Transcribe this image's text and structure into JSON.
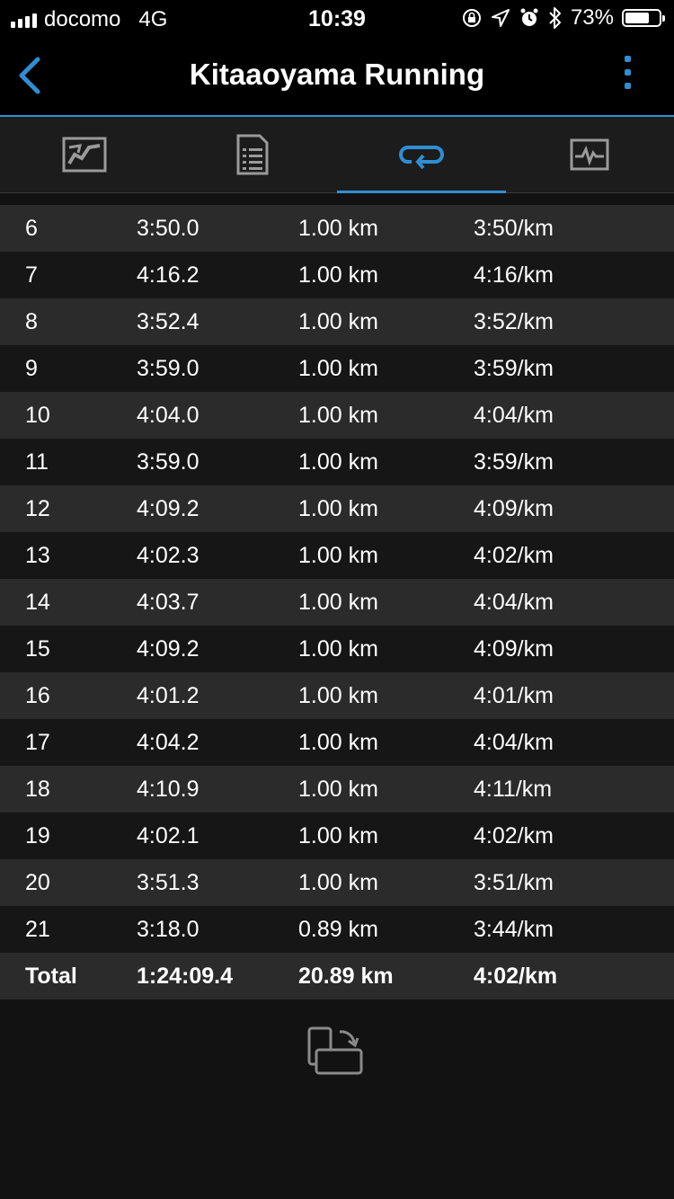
{
  "status_bar": {
    "carrier": "docomo",
    "network": "4G",
    "time": "10:39",
    "battery": "73%",
    "battery_level": 0.73,
    "icons": [
      "orientation-lock-icon",
      "location-icon",
      "alarm-icon",
      "bluetooth-icon"
    ]
  },
  "header": {
    "title": "Kitaaoyama Running",
    "back_icon": "chevron-left-icon",
    "more_icon": "vertical-dots-icon",
    "accent": "#2f8ed3"
  },
  "tabs": [
    {
      "icon": "map-icon",
      "active": false
    },
    {
      "icon": "summary-list-icon",
      "active": false
    },
    {
      "icon": "laps-icon",
      "active": true
    },
    {
      "icon": "charts-icon",
      "active": false
    }
  ],
  "laps": {
    "rows": [
      {
        "lap": "6",
        "time": "3:50.0",
        "distance": "1.00 km",
        "pace": "3:50/km"
      },
      {
        "lap": "7",
        "time": "4:16.2",
        "distance": "1.00 km",
        "pace": "4:16/km"
      },
      {
        "lap": "8",
        "time": "3:52.4",
        "distance": "1.00 km",
        "pace": "3:52/km"
      },
      {
        "lap": "9",
        "time": "3:59.0",
        "distance": "1.00 km",
        "pace": "3:59/km"
      },
      {
        "lap": "10",
        "time": "4:04.0",
        "distance": "1.00 km",
        "pace": "4:04/km"
      },
      {
        "lap": "11",
        "time": "3:59.0",
        "distance": "1.00 km",
        "pace": "3:59/km"
      },
      {
        "lap": "12",
        "time": "4:09.2",
        "distance": "1.00 km",
        "pace": "4:09/km"
      },
      {
        "lap": "13",
        "time": "4:02.3",
        "distance": "1.00 km",
        "pace": "4:02/km"
      },
      {
        "lap": "14",
        "time": "4:03.7",
        "distance": "1.00 km",
        "pace": "4:04/km"
      },
      {
        "lap": "15",
        "time": "4:09.2",
        "distance": "1.00 km",
        "pace": "4:09/km"
      },
      {
        "lap": "16",
        "time": "4:01.2",
        "distance": "1.00 km",
        "pace": "4:01/km"
      },
      {
        "lap": "17",
        "time": "4:04.2",
        "distance": "1.00 km",
        "pace": "4:04/km"
      },
      {
        "lap": "18",
        "time": "4:10.9",
        "distance": "1.00 km",
        "pace": "4:11/km"
      },
      {
        "lap": "19",
        "time": "4:02.1",
        "distance": "1.00 km",
        "pace": "4:02/km"
      },
      {
        "lap": "20",
        "time": "3:51.3",
        "distance": "1.00 km",
        "pace": "3:51/km"
      },
      {
        "lap": "21",
        "time": "3:18.0",
        "distance": "0.89 km",
        "pace": "3:44/km"
      }
    ],
    "total": {
      "lap": "Total",
      "time": "1:24:09.4",
      "distance": "20.89 km",
      "pace": "4:02/km"
    }
  },
  "rotate_icon": "rotate-device-icon"
}
